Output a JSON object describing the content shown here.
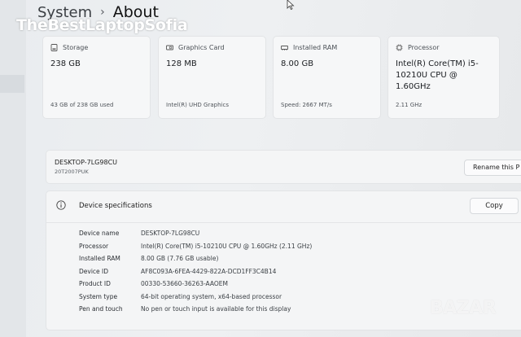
{
  "breadcrumb": {
    "parent": "System",
    "separator": "›",
    "current": "About"
  },
  "watermark": "TheBestLaptopSofia",
  "cards": [
    {
      "label": "Storage",
      "value": "238 GB",
      "sub": "43 GB of 238 GB used",
      "icon": "storage-icon"
    },
    {
      "label": "Graphics Card",
      "value": "128 MB",
      "sub": "Intel(R) UHD Graphics",
      "icon": "graphics-card-icon"
    },
    {
      "label": "Installed RAM",
      "value": "8.00 GB",
      "sub": "Speed: 2667 MT/s",
      "icon": "ram-icon"
    },
    {
      "label": "Processor",
      "value": "Intel(R) Core(TM) i5-10210U CPU @ 1.60GHz",
      "sub": "2.11 GHz",
      "icon": "processor-icon"
    }
  ],
  "device": {
    "name": "DESKTOP-7LG98CU",
    "model": "20T2007PUK",
    "rename_label": "Rename this P"
  },
  "specs": {
    "title": "Device specifications",
    "copy_label": "Copy",
    "rows": [
      {
        "label": "Device name",
        "value": "DESKTOP-7LG98CU"
      },
      {
        "label": "Processor",
        "value": "Intel(R) Core(TM) i5-10210U CPU @ 1.60GHz (2.11 GHz)"
      },
      {
        "label": "Installed RAM",
        "value": "8.00 GB (7.76 GB usable)"
      },
      {
        "label": "Device ID",
        "value": "AF8C093A-6FEA-4429-822A-DCD1FF3C4B14"
      },
      {
        "label": "Product ID",
        "value": "00330-53660-36263-AAOEM"
      },
      {
        "label": "System type",
        "value": "64-bit operating system, x64-based processor"
      },
      {
        "label": "Pen and touch",
        "value": "No pen or touch input is available for this display"
      }
    ]
  },
  "bazar_logo": "BAZAR",
  "colors": {
    "page_bg": "#eceef0",
    "card_bg": "#f6f7f8",
    "border": "#e2e4e6",
    "text": "#1f2328"
  }
}
